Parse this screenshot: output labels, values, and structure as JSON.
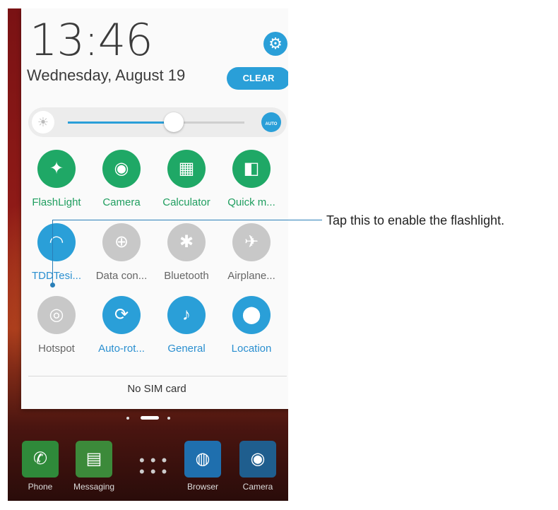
{
  "status": {
    "time": "13:46",
    "date": "Wednesday, August 19"
  },
  "buttons": {
    "clear": "CLEAR"
  },
  "brightness": {
    "level": 0.6,
    "auto_label": "AUTO"
  },
  "tiles": [
    {
      "label": "FlashLight",
      "icon": "flashlight-icon",
      "glyph": "✦",
      "state": "green"
    },
    {
      "label": "Camera",
      "icon": "camera-icon",
      "glyph": "◉",
      "state": "green"
    },
    {
      "label": "Calculator",
      "icon": "calculator-icon",
      "glyph": "▦",
      "state": "green"
    },
    {
      "label": "Quick m...",
      "icon": "quick-memo-icon",
      "glyph": "◧",
      "state": "green"
    },
    {
      "label": "TDDTesi...",
      "icon": "wifi-icon",
      "glyph": "◠",
      "state": "blue"
    },
    {
      "label": "Data con...",
      "icon": "data-connection-icon",
      "glyph": "⊕",
      "state": "grey"
    },
    {
      "label": "Bluetooth",
      "icon": "bluetooth-icon",
      "glyph": "✱",
      "state": "grey"
    },
    {
      "label": "Airplane...",
      "icon": "airplane-icon",
      "glyph": "✈",
      "state": "grey"
    },
    {
      "label": "Hotspot",
      "icon": "hotspot-icon",
      "glyph": "◎",
      "state": "grey"
    },
    {
      "label": "Auto-rot...",
      "icon": "auto-rotate-icon",
      "glyph": "⟳",
      "state": "blue"
    },
    {
      "label": "General",
      "icon": "sound-general-icon",
      "glyph": "♪",
      "state": "blue"
    },
    {
      "label": "Location",
      "icon": "location-icon",
      "glyph": "⬤",
      "state": "blue"
    }
  ],
  "sim": "No SIM card",
  "dock": [
    {
      "label": "Phone",
      "color": "#2f8a3a",
      "glyph": "✆"
    },
    {
      "label": "Messaging",
      "color": "#3c8a3a",
      "glyph": "▤"
    },
    {
      "label": "Browser",
      "color": "#1f6fae",
      "glyph": "◍"
    },
    {
      "label": "Camera",
      "color": "#1f5e8e",
      "glyph": "◉"
    }
  ],
  "callout": "Tap this to enable the flashlight."
}
